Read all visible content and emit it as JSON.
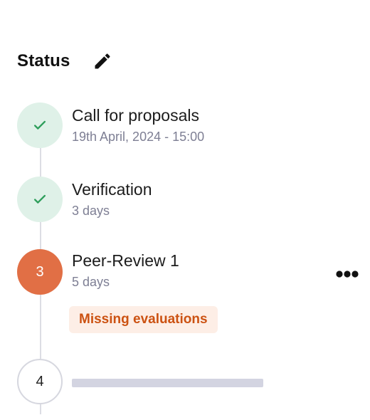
{
  "header": {
    "title": "Status",
    "edit_icon": "pencil-icon"
  },
  "colors": {
    "done_circle_bg": "#dff1e8",
    "done_check": "#2e9e5b",
    "active_circle_bg": "#e16f45",
    "badge_bg": "#fdeee6",
    "badge_text": "#cc5212",
    "muted_text": "#7e7f94",
    "skeleton": "#d3d4e1"
  },
  "steps": [
    {
      "state": "done",
      "icon": "check-icon",
      "title": "Call for proposals",
      "subtitle": "19th April, 2024 - 15:00"
    },
    {
      "state": "done",
      "icon": "check-icon",
      "title": "Verification",
      "subtitle": "3 days"
    },
    {
      "state": "active",
      "number": "3",
      "title": "Peer-Review 1",
      "subtitle": "5 days",
      "badge": "Missing evaluations",
      "menu_icon": "more-horizontal-icon"
    },
    {
      "state": "pending",
      "number": "4",
      "title": "",
      "subtitle": ""
    }
  ]
}
